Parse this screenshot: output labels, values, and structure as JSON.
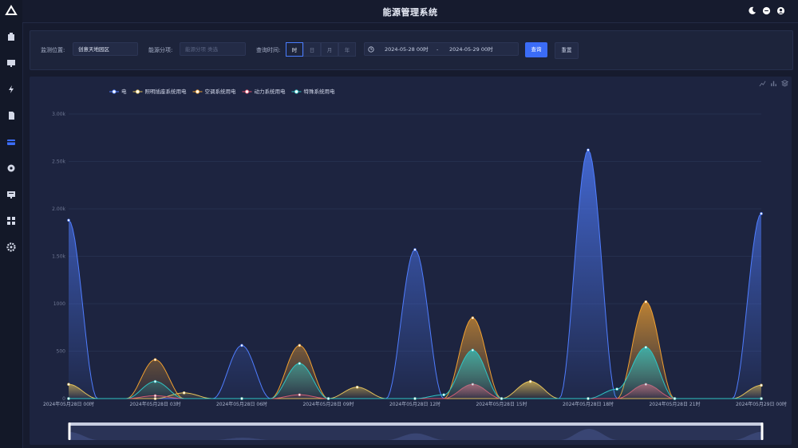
{
  "app": {
    "title": "能源管理系统"
  },
  "sidebar": {
    "icons": [
      "logo-icon",
      "building-icon",
      "monitor-icon",
      "lightning-icon",
      "document-icon",
      "card-icon",
      "location-icon",
      "report-icon",
      "grid-icon",
      "settings-icon"
    ]
  },
  "header_icons": [
    "moon-icon",
    "message-icon",
    "user-icon"
  ],
  "filters": {
    "location_label": "监测位置:",
    "location_value": "创意天地园区",
    "category_label": "能源分项:",
    "category_placeholder": "能源分项 类选",
    "time_label": "查询时间:",
    "time_units": [
      "时",
      "日",
      "月",
      "年"
    ],
    "time_unit_selected": "时",
    "start_time": "2024-05-28 00时",
    "separator": "-",
    "end_time": "2024-05-29 00时",
    "query_button": "查询",
    "reset_button": "重置"
  },
  "colors": {
    "accent": "#3b6cf6",
    "series": [
      "#4f7dff",
      "#e3c15a",
      "#f0c040",
      "#e0506a",
      "#2ec5c5"
    ]
  },
  "toolbox_icons": [
    "line-chart-icon",
    "bar-chart-icon",
    "stack-icon"
  ],
  "chart_data": {
    "type": "area",
    "smooth": true,
    "legend_position": "top-left",
    "grid": true,
    "ylim": [
      0,
      3000
    ],
    "y_ticks": [
      "0",
      "500",
      "1000",
      "1.50k",
      "2.00k",
      "2.50k",
      "3.00k"
    ],
    "x_labels": [
      "2024年05月28日 00时",
      "2024年05月28日 03时",
      "2024年05月28日 06时",
      "2024年05月28日 09时",
      "2024年05月28日 12时",
      "2024年05月28日 15时",
      "2024年05月28日 18时",
      "2024年05月28日 21时",
      "2024年05月29日 00时"
    ],
    "points_per_day": 24,
    "series": [
      {
        "name": "电",
        "color": "#4f7dff",
        "values": [
          1880,
          0,
          0,
          0,
          0,
          0,
          560,
          0,
          0,
          0,
          0,
          0,
          1570,
          0,
          0,
          0,
          0,
          0,
          2620,
          0,
          0,
          0,
          0,
          0,
          1950
        ]
      },
      {
        "name": "照明插座系统用电",
        "color": "#e3c15a",
        "values": [
          150,
          0,
          0,
          0,
          60,
          0,
          0,
          0,
          0,
          0,
          120,
          0,
          0,
          0,
          0,
          0,
          180,
          0,
          0,
          0,
          0,
          0,
          0,
          0,
          140
        ]
      },
      {
        "name": "空调系统用电",
        "color": "#f0a030",
        "values": [
          0,
          0,
          0,
          410,
          0,
          0,
          0,
          0,
          560,
          0,
          0,
          0,
          0,
          0,
          850,
          0,
          0,
          0,
          0,
          0,
          1020,
          0,
          0,
          0,
          0
        ]
      },
      {
        "name": "动力系统用电",
        "color": "#e0506a",
        "values": [
          0,
          0,
          0,
          30,
          0,
          0,
          0,
          0,
          40,
          0,
          0,
          0,
          0,
          0,
          150,
          0,
          0,
          0,
          0,
          0,
          150,
          0,
          0,
          0,
          0
        ]
      },
      {
        "name": "特殊系统用电",
        "color": "#2ec5c5",
        "values": [
          0,
          0,
          0,
          180,
          0,
          0,
          0,
          0,
          370,
          0,
          0,
          0,
          0,
          40,
          510,
          0,
          0,
          0,
          0,
          100,
          540,
          0,
          0,
          0,
          0
        ]
      }
    ]
  }
}
